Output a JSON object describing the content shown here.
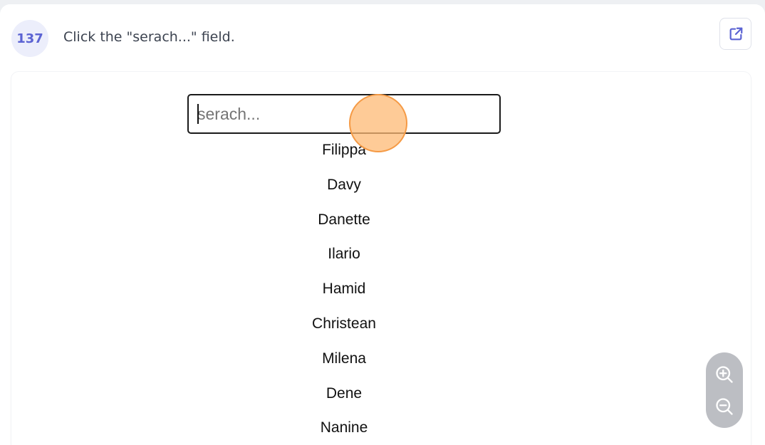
{
  "header": {
    "step_number": "137",
    "instruction": "Click the \"serach...\" field."
  },
  "icons": {
    "open": "external-link-icon",
    "zoom_in": "zoom-in-icon",
    "zoom_out": "zoom-out-icon"
  },
  "colors": {
    "accent": "#5b63d3",
    "marker": "#fdba74"
  },
  "search": {
    "placeholder": "serach...",
    "value": ""
  },
  "names": [
    "Filippa",
    "Davy",
    "Danette",
    "Ilario",
    "Hamid",
    "Christean",
    "Milena",
    "Dene",
    "Nanine"
  ]
}
